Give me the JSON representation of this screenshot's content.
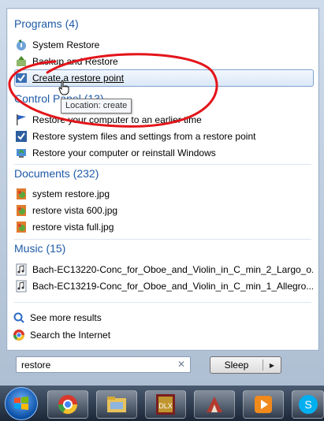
{
  "sections": {
    "programs": {
      "header": "Programs (4)",
      "items": [
        {
          "label": "System Restore",
          "icon": "system-restore-icon"
        },
        {
          "label": "Backup and Restore",
          "icon": "backup-restore-icon"
        },
        {
          "label": "Create a restore point",
          "icon": "restore-point-icon"
        }
      ]
    },
    "control_panel": {
      "header": "Control Panel (13)",
      "items": [
        {
          "label": "Restore your computer to an earlier time",
          "icon": "flag-icon"
        },
        {
          "label": "Restore system files and settings from a restore point",
          "icon": "checkbox-icon"
        },
        {
          "label": "Restore your computer or reinstall Windows",
          "icon": "recovery-icon"
        }
      ]
    },
    "documents": {
      "header": "Documents (232)",
      "items": [
        {
          "label": "system restore.jpg",
          "icon": "image-file-icon"
        },
        {
          "label": "restore vista 600.jpg",
          "icon": "image-file-icon"
        },
        {
          "label": "restore vista full.jpg",
          "icon": "image-file-icon"
        }
      ]
    },
    "music": {
      "header": "Music (15)",
      "items": [
        {
          "label": "Bach-EC13220-Conc_for_Oboe_and_Violin_in_C_min_2_Largo_o...",
          "icon": "audio-file-icon"
        },
        {
          "label": "Bach-EC13219-Conc_for_Oboe_and_Violin_in_C_min_1_Allegro...",
          "icon": "audio-file-icon"
        }
      ]
    }
  },
  "tooltip": "Location: create",
  "links": {
    "see_more": "See more results",
    "search_internet": "Search the Internet"
  },
  "search": {
    "value": "restore",
    "clear": "✕"
  },
  "power": {
    "label": "Sleep",
    "arrow": "▶"
  },
  "taskbar": [
    "windows-start-orb",
    "chrome-icon",
    "explorer-icon",
    "dlx-app-icon",
    "app-icon",
    "media-player-icon",
    "skype-icon"
  ],
  "colors": {
    "header": "#1e5aa8",
    "selection": "#dbe8f7",
    "annotation": "#e3151a"
  }
}
